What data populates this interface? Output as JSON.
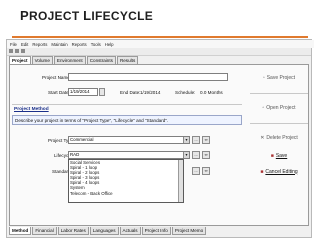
{
  "slide": {
    "title": "Project Lifecycle",
    "title_first": "P",
    "title_rest1": "ROJECT ",
    "title_second": "L",
    "title_rest2": "IFECYCLE"
  },
  "app": {
    "menu": [
      "File",
      "Edit",
      "Reports",
      "Maintain",
      "Reports",
      "Tools",
      "Help"
    ],
    "tabs": [
      "Project",
      "Volume",
      "Environment",
      "Constraints",
      "Results"
    ],
    "active_tab": "Project",
    "form": {
      "project_name_label": "Project Name",
      "project_name_value": "",
      "start_date_label": "Start Date",
      "start_date_value": "1/19/2014",
      "end_date_label": "End Date:",
      "end_date_value": "1/19/2014",
      "schedule_label": "Schedule:",
      "schedule_value": "0.0 Months",
      "method_section_label": "Project Method",
      "method_description": "Describe your project in terms of \"Project Type\", \"Lifecycle\" and \"Standard\".",
      "project_type_label": "Project Type",
      "project_type_value": "Commercial",
      "lifecycle_label": "Lifecycle",
      "lifecycle_value": "RAD",
      "standard_label": "Standard"
    },
    "lifecycle_options": [
      "RAD",
      "Social Services",
      "Spiral - 1 loop",
      "Spiral - 2 loops",
      "Spiral - 3 loops",
      "Spiral - 4 loops",
      "System",
      "Telecom - Back Office"
    ],
    "buttons": {
      "save_project": "Save Project",
      "open_project": "Open Project",
      "delete_project": "Delete Project",
      "save": "Save",
      "cancel_editing": "Cancel Editing",
      "ellipsis": "...",
      "binoculars": "∞"
    },
    "bottom_tabs": [
      "Method",
      "Financial",
      "Labor Rates",
      "Languages",
      "Actuals",
      "Project Info",
      "Project Memo"
    ],
    "active_bottom_tab": "Method"
  }
}
